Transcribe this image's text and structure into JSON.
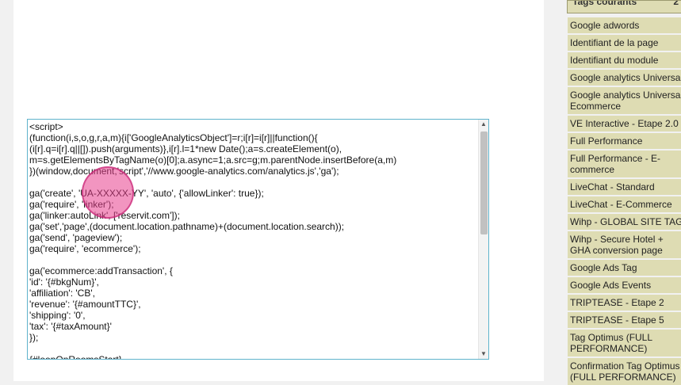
{
  "editor": {
    "lines": [
      "<script>",
      "(function(i,s,o,g,r,a,m){i['GoogleAnalyticsObject']=r;i[r]=i[r]||function(){",
      "(i[r].q=i[r].q||[]).push(arguments)},i[r].l=1*new Date();a=s.createElement(o),",
      "m=s.getElementsByTagName(o)[0];a.async=1;a.src=g;m.parentNode.insertBefore(a,m)",
      "})(window,document,'script','//www.google-analytics.com/analytics.js','ga');",
      "",
      "ga('create', 'UA-XXXXX-YY', 'auto', {'allowLinker': true});",
      "ga('require', 'linker');",
      "ga('linker:autoLink', ['reservit.com']);",
      "ga('set','page',(document.location.pathname)+(document.location.search));",
      "ga('send', 'pageview');",
      "ga('require', 'ecommerce');",
      "",
      "ga('ecommerce:addTransaction', {",
      "'id': '{#bkgNum}',",
      "'affiliation': 'CB',",
      "'revenue': '{#amountTTC}',",
      "'shipping': '0',",
      "'tax': '{#taxAmount}'",
      "});",
      "",
      "{#loopOnRoomsStart}"
    ]
  },
  "sidebar": {
    "header_label": "Tags courants",
    "header_count": "2",
    "tags": [
      "Google adwords",
      "Identifiant de la page",
      "Identifiant du module",
      "Google analytics Universal",
      "Google analytics Universal Ecommerce",
      "VE Interactive - Etape 2.0",
      "Full Performance",
      "Full Performance - E-commerce",
      "LiveChat - Standard",
      "LiveChat - E-Commerce",
      "Wihp - GLOBAL SITE TAG",
      "Wihp - Secure Hotel + GHA conversion page",
      "Google Ads Tag",
      "Google Ads Events",
      "TRIPTEASE - Etape 2",
      "TRIPTEASE - Etape 5",
      "Tag Optimus (FULL PERFORMANCE)",
      "Confirmation Tag Optimus (FULL PERFORMANCE)"
    ]
  },
  "icons": {
    "scroll_up": "scroll-up-arrow",
    "scroll_down": "scroll-down-arrow"
  },
  "colors": {
    "editor_border": "#5fb3cc",
    "tag_background": "#dedcb3",
    "click_marker": "#e83e8c"
  }
}
